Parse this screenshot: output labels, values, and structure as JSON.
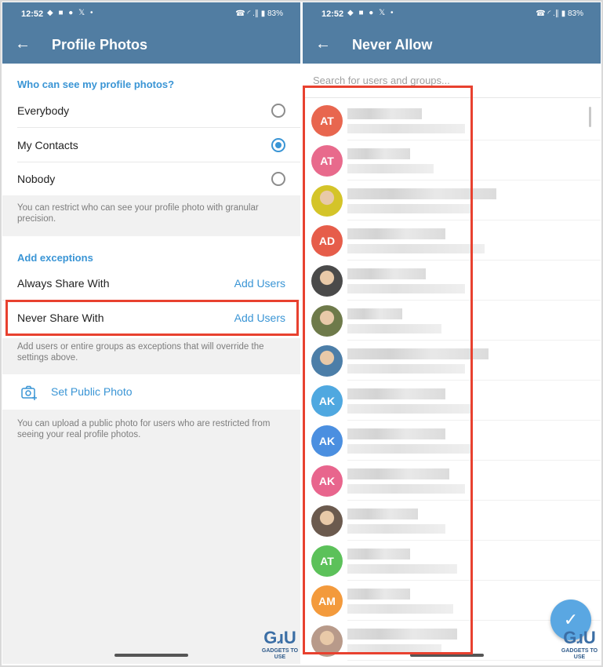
{
  "status_bar": {
    "time": "12:52",
    "battery": "83%",
    "left_icons": "◆ ■ ● 𝕏 •",
    "right_icons": "☎ ◜ .∥ ▮"
  },
  "left_screen": {
    "title": "Profile Photos",
    "who_header": "Who can see my profile photos?",
    "options": [
      {
        "label": "Everybody",
        "selected": false
      },
      {
        "label": "My Contacts",
        "selected": true
      },
      {
        "label": "Nobody",
        "selected": false
      }
    ],
    "restrict_hint": "You can restrict who can see your profile photo with granular precision.",
    "exceptions_header": "Add exceptions",
    "always_share": {
      "label": "Always Share With",
      "action": "Add Users"
    },
    "never_share": {
      "label": "Never Share With",
      "action": "Add Users"
    },
    "exceptions_hint": "Add users or entire groups as exceptions that will override the settings above.",
    "public_photo": {
      "label": "Set Public Photo",
      "icon": "camera-plus-icon"
    },
    "public_hint": "You can upload a public photo for users who are restricted from seeing your real profile photos."
  },
  "right_screen": {
    "title": "Never Allow",
    "search_placeholder": "Search for users and groups...",
    "contacts": [
      {
        "initials": "AT",
        "color": "#e8664f"
      },
      {
        "initials": "AT",
        "color": "#e86a8c"
      },
      {
        "initials": "",
        "color": "#d4c429"
      },
      {
        "initials": "AD",
        "color": "#e65d4a"
      },
      {
        "initials": "",
        "color": "#4a4a4a"
      },
      {
        "initials": "",
        "color": "#6e7a4a"
      },
      {
        "initials": "",
        "color": "#4c7ea8"
      },
      {
        "initials": "AK",
        "color": "#4fa8e0"
      },
      {
        "initials": "AK",
        "color": "#4b8fe0"
      },
      {
        "initials": "AK",
        "color": "#e8658d"
      },
      {
        "initials": "",
        "color": "#6b5a4e"
      },
      {
        "initials": "AT",
        "color": "#5cc15a"
      },
      {
        "initials": "AM",
        "color": "#f39a3c"
      },
      {
        "initials": "",
        "color": "#b89a8a"
      }
    ],
    "fab_icon": "✓"
  },
  "watermark": {
    "brand": "GɹU",
    "tagline": "GADGETS TO USE"
  },
  "colors": {
    "header": "#517da2",
    "accent": "#3a95d5",
    "highlight": "#e8412f"
  }
}
